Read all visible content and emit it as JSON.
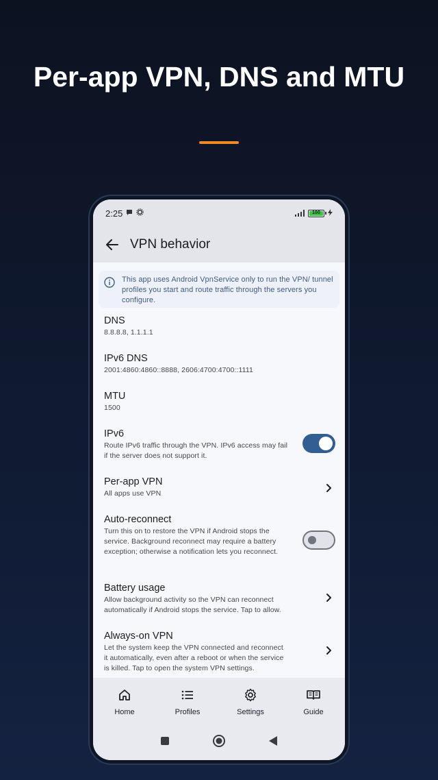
{
  "headline": "Per-app VPN, DNS and MTU",
  "colors": {
    "accent": "#f08a24",
    "toggle_on": "#335e93",
    "info_text": "#3e5c80",
    "battery": "#3cc44a"
  },
  "statusbar": {
    "time": "2:25",
    "battery_level": "100"
  },
  "appbar": {
    "title": "VPN behavior"
  },
  "info": {
    "text": "This app uses Android VpnService only to run the VPN/ tunnel profiles you start and route traffic through the servers you configure."
  },
  "settings": [
    {
      "title": "DNS",
      "subtitle": "8.8.8.8, 1.1.1.1",
      "control": "none"
    },
    {
      "title": "IPv6 DNS",
      "subtitle": "2001:4860:4860::8888, 2606:4700:4700::1111",
      "control": "none"
    },
    {
      "title": "MTU",
      "subtitle": "1500",
      "control": "none"
    },
    {
      "title": "IPv6",
      "subtitle": "Route IPv6 traffic through the VPN. IPv6 access may fail if the server does not support it.",
      "control": "toggle",
      "enabled": true
    },
    {
      "title": "Per-app VPN",
      "subtitle": "All apps use VPN",
      "control": "chevron"
    },
    {
      "title": "Auto-reconnect",
      "subtitle": "Turn this on to restore the VPN if Android stops the service. Background reconnect may require a battery exception; otherwise a notification lets you reconnect.",
      "control": "toggle",
      "enabled": false
    },
    {
      "title": "Battery usage",
      "subtitle": "Allow background activity so the VPN can reconnect automatically if Android stops the service. Tap to allow.",
      "control": "chevron"
    },
    {
      "title": "Always-on VPN",
      "subtitle": "Let the system keep the VPN connected and reconnect it automatically, even after a reboot or when the service is killed. Tap to open the system VPN settings.",
      "control": "chevron"
    }
  ],
  "bottomnav": [
    {
      "label": "Home",
      "icon": "home-icon"
    },
    {
      "label": "Profiles",
      "icon": "list-icon"
    },
    {
      "label": "Settings",
      "icon": "gear-icon"
    },
    {
      "label": "Guide",
      "icon": "book-icon"
    }
  ],
  "sysnav": [
    {
      "icon": "recents-square-icon"
    },
    {
      "icon": "home-circle-icon"
    },
    {
      "icon": "back-triangle-icon"
    }
  ]
}
